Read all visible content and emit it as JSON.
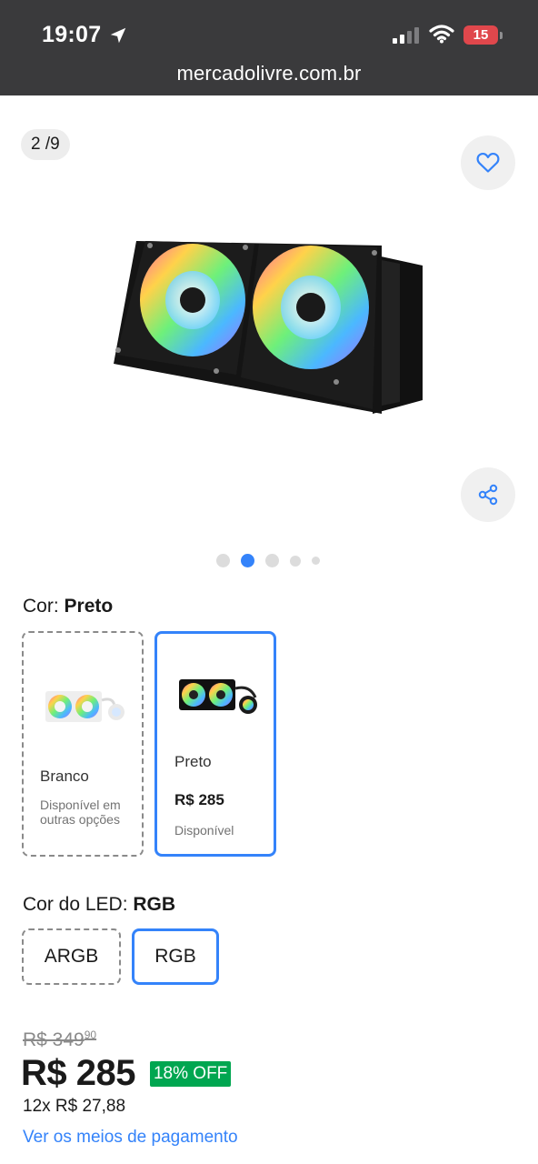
{
  "status_bar": {
    "time": "19:07",
    "battery": "15"
  },
  "browser": {
    "url": "mercadolivre.com.br"
  },
  "gallery": {
    "counter": "2 /9",
    "active_index": 1,
    "total_dots": 5
  },
  "color": {
    "label": "Cor: ",
    "selected": "Preto",
    "options": [
      {
        "name": "Branco",
        "price": "",
        "availability": "Disponível em outras opções",
        "selected": false
      },
      {
        "name": "Preto",
        "price": "R$ 285",
        "availability": "Disponível",
        "selected": true
      }
    ]
  },
  "led": {
    "label": "Cor do LED: ",
    "selected": "RGB",
    "options": [
      {
        "name": "ARGB",
        "selected": false
      },
      {
        "name": "RGB",
        "selected": true
      }
    ]
  },
  "price": {
    "old_integer": "R$ 349",
    "old_cents": "90",
    "current": "R$ 285",
    "discount": "18% OFF",
    "installments": "12x R$ 27,88",
    "payment_link": "Ver os meios de pagamento"
  },
  "colors": {
    "accent": "#3483fa",
    "discount_bg": "#00a650",
    "topbar": "#3a3a3c"
  }
}
